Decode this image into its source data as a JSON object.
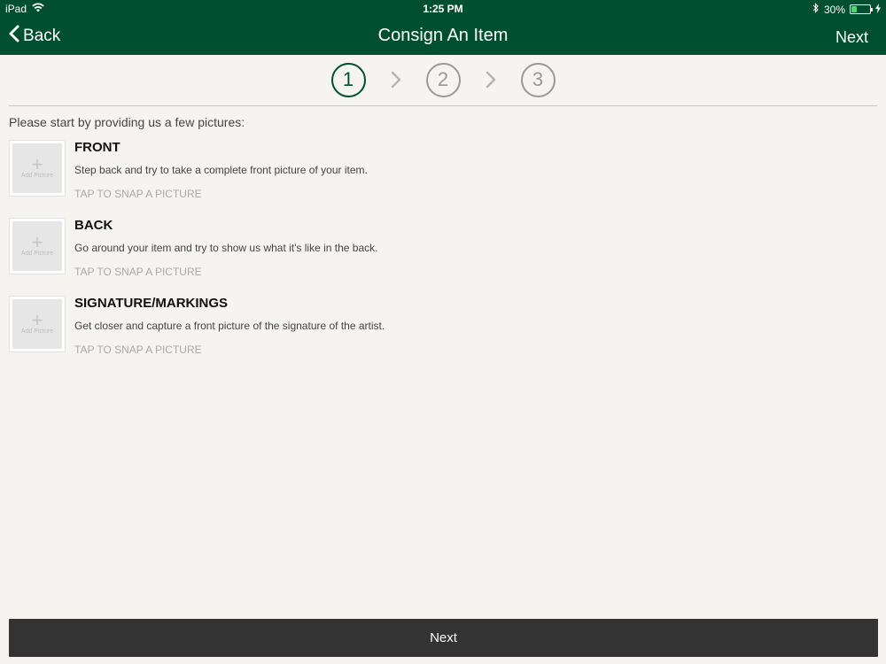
{
  "status": {
    "device": "iPad",
    "time": "1:25 PM",
    "battery_text": "30%",
    "battery_level": 0.3
  },
  "nav": {
    "back_label": "Back",
    "title": "Consign An Item",
    "next_label": "Next"
  },
  "steps": [
    "1",
    "2",
    "3"
  ],
  "active_step": 0,
  "intro_text": "Please start by providing us a few pictures:",
  "items": [
    {
      "title": "FRONT",
      "description": "Step back and try to take a complete front picture of your item.",
      "tap_label": "TAP TO SNAP A PICTURE",
      "thumb_label": "Add Picture"
    },
    {
      "title": "BACK",
      "description": "Go around your item and try to show us what it's like in the back.",
      "tap_label": "TAP TO SNAP A PICTURE",
      "thumb_label": "Add Picture"
    },
    {
      "title": "SIGNATURE/MARKINGS",
      "description": "Get closer and capture a front picture of the signature of the artist.",
      "tap_label": "TAP TO SNAP A PICTURE",
      "thumb_label": "Add Picture"
    }
  ],
  "bottom_button_label": "Next",
  "colors": {
    "header": "#004f30",
    "background": "#f5f4f0",
    "bottom_button": "#333333",
    "active_step": "#004f30"
  }
}
